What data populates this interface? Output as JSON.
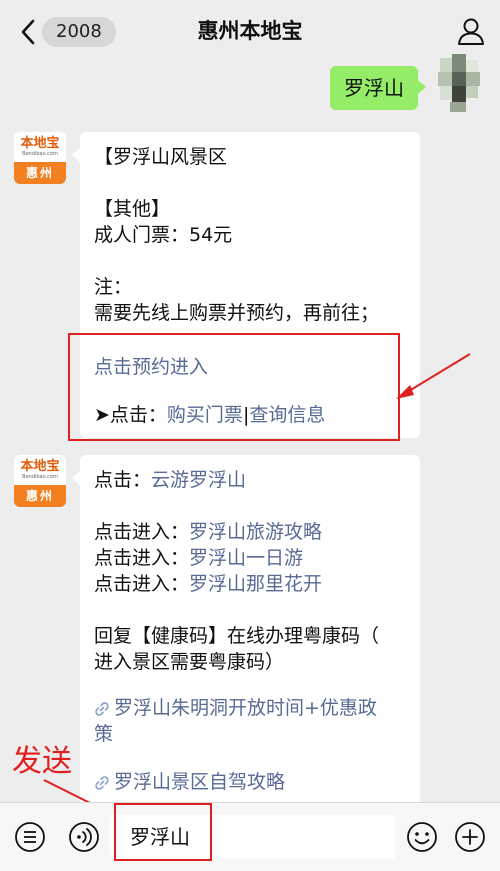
{
  "header": {
    "back_badge": "2008",
    "title": "惠州本地宝"
  },
  "avatar": {
    "brand": "本地宝",
    "url": "Bendibao.com",
    "city": "惠州"
  },
  "outgoing": {
    "text": "罗浮山"
  },
  "message1": {
    "line1": "【罗浮山风景区",
    "line2": "【其他】",
    "line3": "成人门票：54元",
    "line4": "注：",
    "line5": "需要先线上购票并预约，再前往；",
    "link_reserve": "点击预约进入",
    "click_prefix": "➤点击：",
    "link_buy": "购买门票",
    "separator": "|",
    "link_query": "查询信息"
  },
  "message2": {
    "click_label": "点击：",
    "link_cloud": "云游罗浮山",
    "enter_label": "点击进入：",
    "link_guide": "罗浮山旅游攻略",
    "link_dayTrip": "罗浮山一日游",
    "link_flowers": "罗浮山那里花开",
    "reply_line1": "回复【健康码】在线办理粤康码（",
    "reply_line2": "进入景区需要粤康码）",
    "article1_line1": "罗浮山朱明洞开放时间+优惠政",
    "article1_line2": "策",
    "article2": "罗浮山景区自驾攻略"
  },
  "annotation": {
    "send_label": "发送"
  },
  "composer": {
    "input_value": "罗浮山"
  },
  "colors": {
    "highlight": "#e02020",
    "link": "#576b95",
    "bubble_green": "#95ec69"
  }
}
